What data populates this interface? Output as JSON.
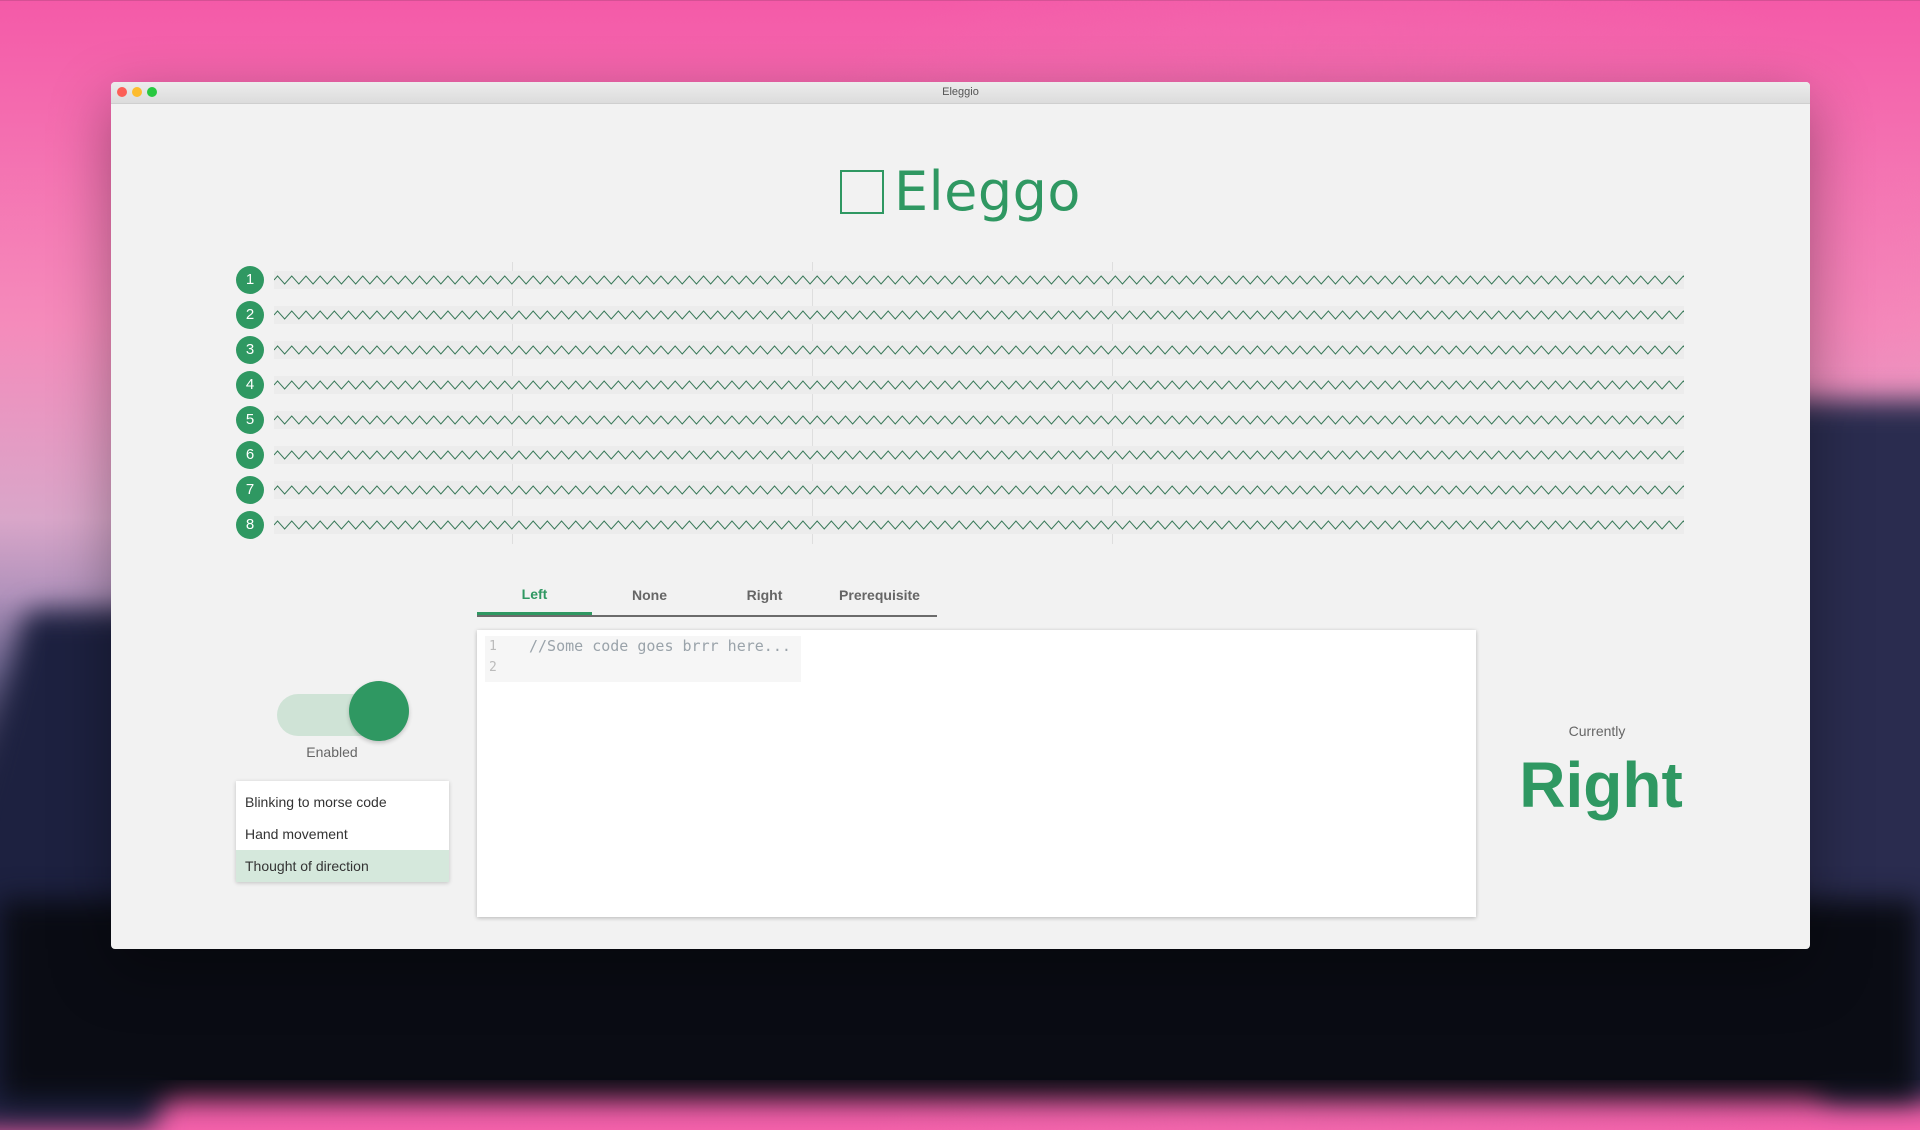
{
  "window": {
    "title": "Eleggio"
  },
  "app": {
    "name": "Eleggo"
  },
  "channels": [
    {
      "label": "1"
    },
    {
      "label": "2"
    },
    {
      "label": "3"
    },
    {
      "label": "4"
    },
    {
      "label": "5"
    },
    {
      "label": "6"
    },
    {
      "label": "7"
    },
    {
      "label": "8"
    }
  ],
  "tabs": [
    {
      "label": "Left",
      "active": true
    },
    {
      "label": "None",
      "active": false
    },
    {
      "label": "Right",
      "active": false
    },
    {
      "label": "Prerequisite",
      "active": false
    }
  ],
  "editor": {
    "lines": [
      {
        "number": "1",
        "text": "//Some code goes brrr here..."
      },
      {
        "number": "2",
        "text": ""
      }
    ]
  },
  "toggle": {
    "label": "Enabled",
    "on": true
  },
  "methods": {
    "items": [
      {
        "label": "Blinking to morse code",
        "selected": false
      },
      {
        "label": "Hand movement",
        "selected": false
      },
      {
        "label": "Thought of direction",
        "selected": true
      }
    ]
  },
  "status": {
    "label": "Currently",
    "value": "Right"
  },
  "colors": {
    "accent": "#2f9862",
    "accent_light": "#cfe3d6",
    "selected_bg": "#d5e8dc"
  },
  "icons": {
    "logo": "square-logo-icon"
  }
}
